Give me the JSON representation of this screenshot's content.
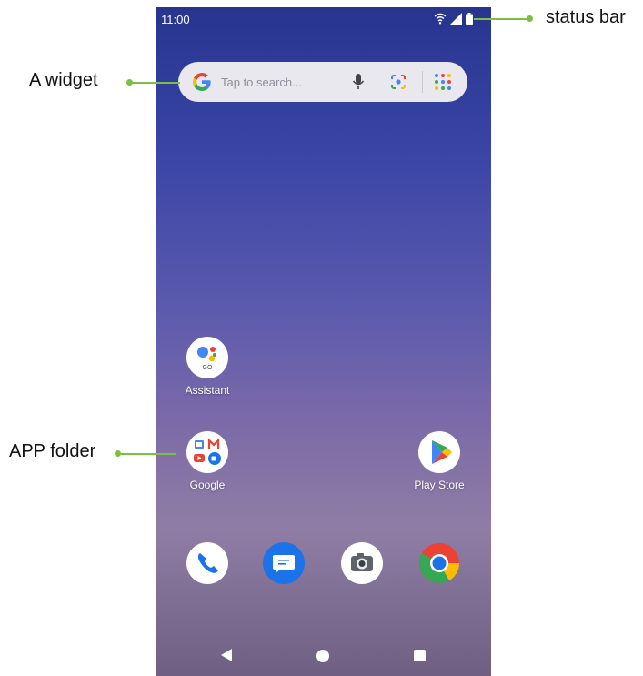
{
  "status_bar": {
    "time": "11:00"
  },
  "search_widget": {
    "placeholder": "Tap to search..."
  },
  "apps": {
    "assistant": "Assistant",
    "google_folder": "Google",
    "play_store": "Play Store"
  },
  "folder_badge": {
    "go": "GO"
  },
  "annotations": {
    "status_bar": "status bar",
    "widget": "A widget",
    "app_folder": "APP folder"
  },
  "colors": {
    "annotation_green": "#7cc043",
    "google_blue": "#4285f4",
    "google_red": "#ea4335",
    "google_yellow": "#fbbc05",
    "google_green": "#34a853"
  },
  "dock": [
    "phone-icon",
    "messages-icon",
    "camera-icon",
    "chrome-icon"
  ],
  "nav": [
    "back-icon",
    "home-icon",
    "recents-icon"
  ]
}
